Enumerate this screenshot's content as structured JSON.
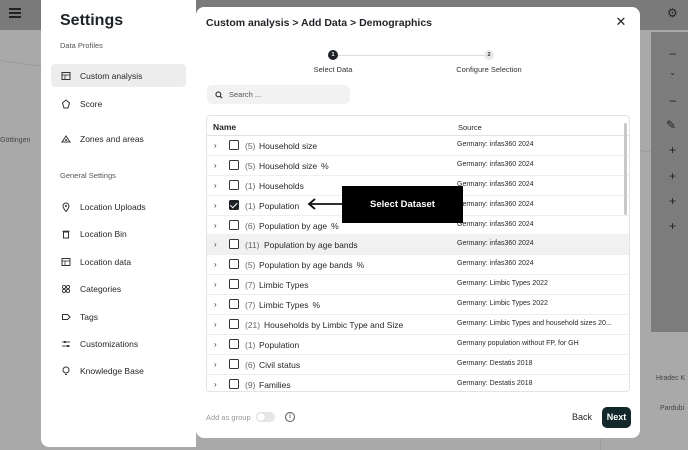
{
  "background": {
    "map_labels": [
      "Göttingen",
      "Hradec K",
      "Pardubi"
    ],
    "right_panel_icons": [
      "chevron-down-icon",
      "minus-icon",
      "pencil-icon",
      "plus-icon"
    ]
  },
  "settings": {
    "title": "Settings",
    "data_profiles_label": "Data Profiles",
    "data_profiles": [
      {
        "label": "Custom analysis",
        "icon": "table-icon",
        "active": true
      },
      {
        "label": "Score",
        "icon": "score-icon",
        "active": false
      },
      {
        "label": "Zones and areas",
        "icon": "zones-icon",
        "active": false
      }
    ],
    "general_label": "General Settings",
    "general_items": [
      {
        "label": "Location Uploads",
        "icon": "pin-icon"
      },
      {
        "label": "Location Bin",
        "icon": "trash-icon"
      },
      {
        "label": "Location data",
        "icon": "table-icon"
      },
      {
        "label": "Categories",
        "icon": "categories-icon"
      },
      {
        "label": "Tags",
        "icon": "tag-icon"
      },
      {
        "label": "Customizations",
        "icon": "sliders-icon"
      },
      {
        "label": "Knowledge Base",
        "icon": "bulb-icon"
      }
    ]
  },
  "dialog": {
    "breadcrumb": "Custom analysis > Add Data > Demographics",
    "steps": [
      {
        "number": "1",
        "label": "Select Data",
        "active": true
      },
      {
        "number": "2",
        "label": "Configure Selection",
        "active": false
      }
    ],
    "search": {
      "placeholder": "Search ...",
      "value": ""
    },
    "columns": {
      "name": "Name",
      "source": "Source"
    },
    "rows": [
      {
        "count": "(5)",
        "name": "Household size",
        "percent": false,
        "checked": false,
        "source": "Germany: infas360 2024"
      },
      {
        "count": "(5)",
        "name": "Household size",
        "percent": true,
        "checked": false,
        "source": "Germany: infas360 2024"
      },
      {
        "count": "(1)",
        "name": "Households",
        "percent": false,
        "checked": false,
        "source": "Germany: infas360 2024"
      },
      {
        "count": "(1)",
        "name": "Population",
        "percent": false,
        "checked": true,
        "source": "Germany: infas360 2024"
      },
      {
        "count": "(6)",
        "name": "Population by age",
        "percent": true,
        "checked": false,
        "source": "Germany: infas360 2024"
      },
      {
        "count": "(11)",
        "name": "Population by age bands",
        "percent": false,
        "checked": false,
        "source": "Germany: infas360 2024",
        "highlight": true
      },
      {
        "count": "(5)",
        "name": "Population by age bands",
        "percent": true,
        "checked": false,
        "source": "Germany: infas360 2024"
      },
      {
        "count": "(7)",
        "name": "Limbic Types",
        "percent": false,
        "checked": false,
        "source": "Germany: Limbic Types 2022"
      },
      {
        "count": "(7)",
        "name": "Limbic Types",
        "percent": true,
        "checked": false,
        "source": "Germany: Limbic Types 2022"
      },
      {
        "count": "(21)",
        "name": "Households by Limbic Type and Size",
        "percent": false,
        "checked": false,
        "source": "Germany: Limbic Types and household sizes 20..."
      },
      {
        "count": "(1)",
        "name": "Population",
        "percent": false,
        "checked": false,
        "source": "Germany population without FP, for GH"
      },
      {
        "count": "(6)",
        "name": "Civil status",
        "percent": false,
        "checked": false,
        "source": "Germany: Destatis 2018"
      },
      {
        "count": "(9)",
        "name": "Families",
        "percent": false,
        "checked": false,
        "source": "Germany: Destatis 2018"
      }
    ],
    "percent_symbol": "%",
    "callout": "Select Dataset",
    "add_as_group": "Add as group",
    "back": "Back",
    "next": "Next"
  }
}
